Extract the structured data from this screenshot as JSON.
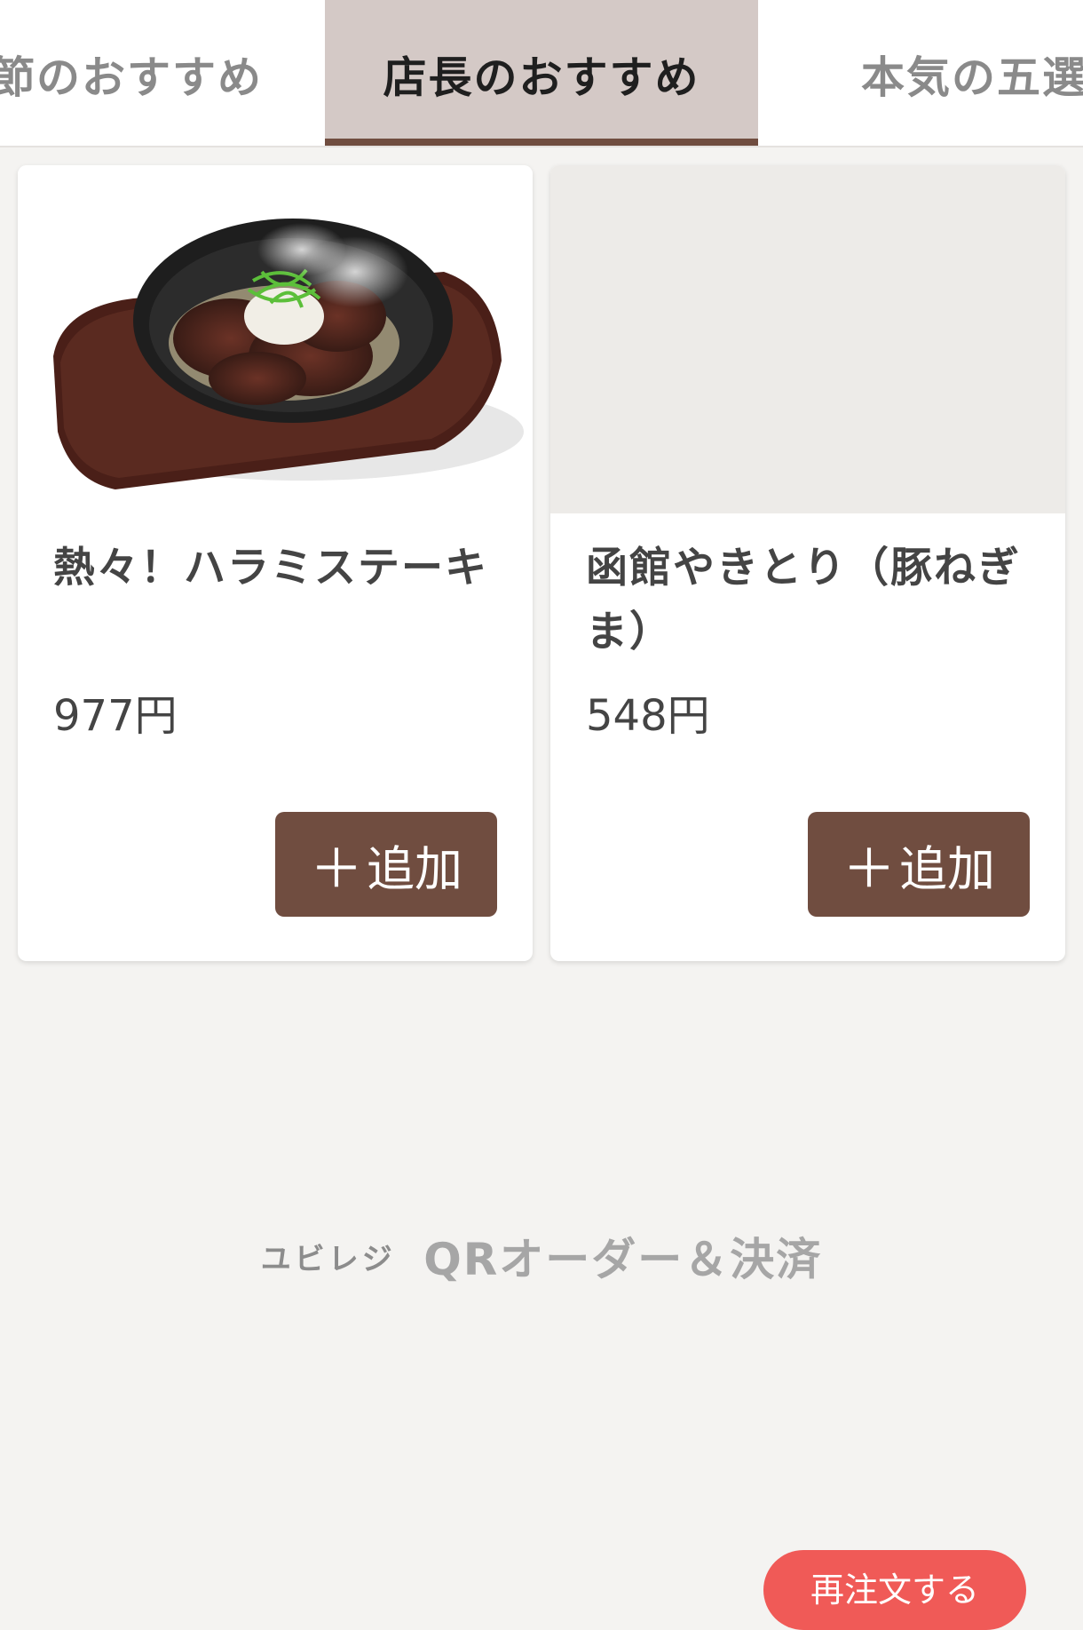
{
  "tabs": [
    {
      "label": "節のおすすめ"
    },
    {
      "label": "店長のおすすめ"
    },
    {
      "label": "本気の五選"
    }
  ],
  "colors": {
    "accent": "#704d40",
    "active_tab_bg": "#d4c9c6",
    "reorder": "#f05a57",
    "background": "#f4f3f1"
  },
  "products": [
    {
      "name": "熱々！ハラミステーキ",
      "price": "977円",
      "add_label": "追加",
      "image": "steak-on-sizzling-plate"
    },
    {
      "name": "函館やきとり（豚ねぎま）",
      "price": "548円",
      "add_label": "追加",
      "image": "image-placeholder"
    }
  ],
  "footer": {
    "brand_small": "ユビレジ",
    "brand_large": "QRオーダー＆決済"
  },
  "reorder": {
    "label": "再注文する"
  }
}
